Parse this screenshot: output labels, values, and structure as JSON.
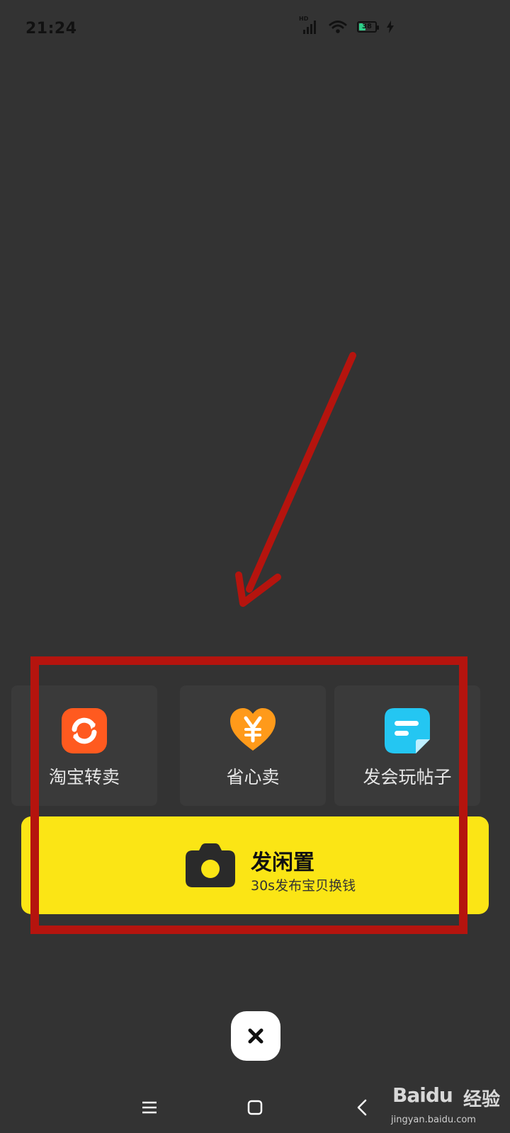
{
  "status_bar": {
    "time": "21:24",
    "network_badge": "HD",
    "battery_percent": "38",
    "icons": [
      "signal-icon",
      "wifi-icon",
      "battery-icon",
      "charging-icon"
    ]
  },
  "quick_actions": [
    {
      "label": "淘宝转卖",
      "icon": "refresh-arrows-icon",
      "color": "#ff5a1f"
    },
    {
      "label": "省心卖",
      "icon": "yen-heart-icon",
      "color": "#ff9a1a"
    },
    {
      "label": "发会玩帖子",
      "icon": "note-icon",
      "color": "#24c6f2"
    }
  ],
  "publish": {
    "title": "发闲置",
    "subtitle": "30s发布宝贝换钱",
    "icon": "camera-icon",
    "background": "#fbe515"
  },
  "close": {
    "icon": "close-icon"
  },
  "nav": {
    "icons": [
      "menu-icon",
      "home-icon",
      "back-icon"
    ]
  },
  "watermark": {
    "brand": "Baidu",
    "product": "经验",
    "url": "jingyan.baidu.com"
  },
  "annotation_color": "#b5140e"
}
